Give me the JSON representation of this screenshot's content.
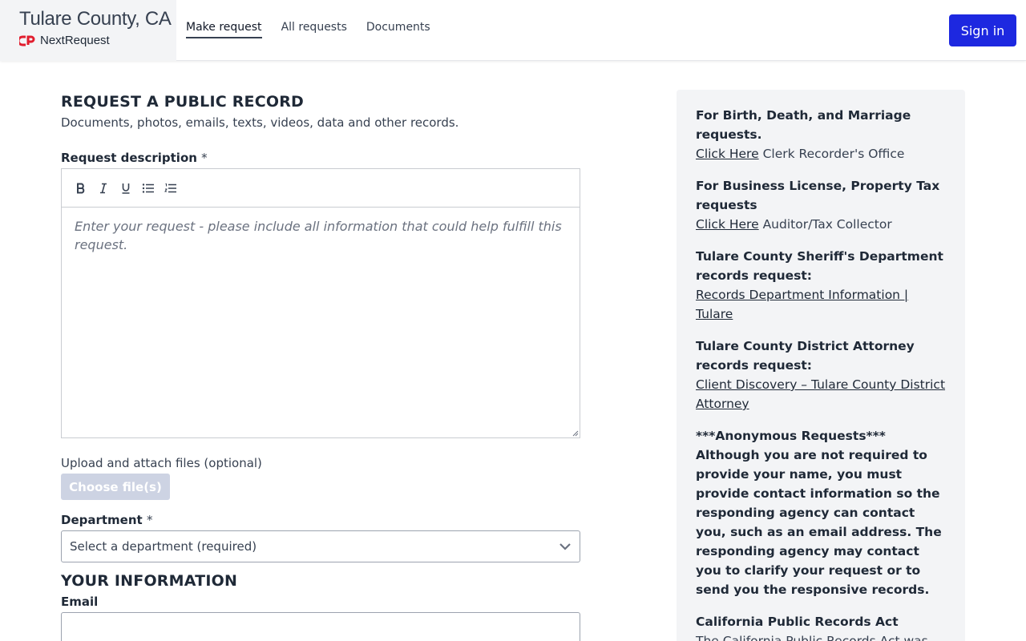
{
  "header": {
    "brand_title": "Tulare County, CA",
    "brand_sub": "NextRequest",
    "nav": [
      {
        "label": "Make request",
        "active": true
      },
      {
        "label": "All requests"
      },
      {
        "label": "Documents"
      }
    ],
    "signin_label": "Sign in"
  },
  "main": {
    "title": "REQUEST A PUBLIC RECORD",
    "subtitle": "Documents, photos, emails, texts, videos, data and other records.",
    "description_label": "Request description",
    "required_mark": "*",
    "toolbar": [
      "bold-icon",
      "italic-icon",
      "underline-icon",
      "bullet-list-icon",
      "numbered-list-icon"
    ],
    "description_placeholder": "Enter your request - please include all information that could help fulfill this request.",
    "upload_label": "Upload and attach files (optional)",
    "choose_files_label": "Choose file(s)",
    "department_label": "Department",
    "department_select": "Select a department (required)",
    "your_info_title": "YOUR INFORMATION",
    "email_label": "Email",
    "email_value": ""
  },
  "sidebar": {
    "birth_title": "For Birth, Death, and Marriage requests.",
    "birth_link": "Click Here",
    "birth_text": "Clerk Recorder's Office",
    "business_title": "For Business License, Property Tax requests",
    "business_link": "Click Here",
    "business_text": "Auditor/Tax Collector",
    "sheriff_title": "Tulare County Sheriff's Department records request:",
    "sheriff_link": "Records Department Information | Tulare",
    "da_title": "Tulare County District Attorney records request:",
    "da_link": "Client Discovery – Tulare County District Attorney",
    "anon_title": "***Anonymous Requests***",
    "anon_text": "Although you are not required to provide your name, you must provide contact information so the responding agency can contact you, such as an email address. The responding agency may contact you to clarify your request or to send you the responsive records.",
    "cpra_title": "California Public Records Act",
    "cpra_text": "The California Public Records Act was"
  },
  "colors": {
    "signin_bg": "#1d28e0",
    "brand_logo": "#e11d2e",
    "sidebar_bg": "#f3f4f6"
  }
}
